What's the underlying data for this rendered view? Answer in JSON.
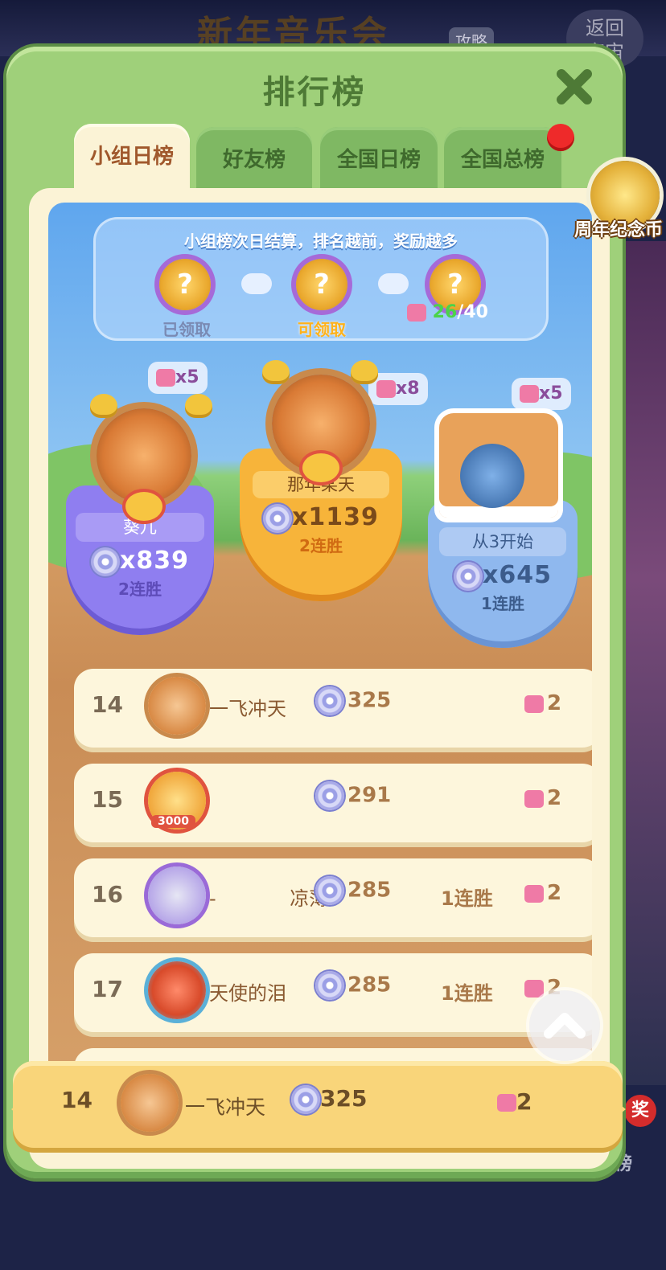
{
  "background": {
    "event_title": "新年音乐会",
    "strategy_tag": "攻略",
    "back_button": "返回\n宇宙",
    "prize_badge": "奖",
    "side_label": "行榜"
  },
  "panel": {
    "title": "排行榜",
    "tabs": [
      {
        "label": "小组日榜",
        "active": true
      },
      {
        "label": "好友榜",
        "active": false
      },
      {
        "label": "全国日榜",
        "active": false
      },
      {
        "label": "全国总榜",
        "active": false
      }
    ],
    "anniversary_coin_label": "周年纪念币"
  },
  "rewards": {
    "hint": "小组榜次日结算，排名越前，奖励越多",
    "chests": [
      {
        "label": "已领取",
        "color": "#7a8ab3"
      },
      {
        "label": "可领取",
        "color": "#ffb21a"
      },
      {
        "label": "",
        "color": "#ffffff"
      }
    ],
    "progress_current": "26",
    "progress_total": "/40"
  },
  "podium": [
    {
      "place": 2,
      "name": "葵儿",
      "score": "x839",
      "streak": "2连胜",
      "reward": "x5",
      "color": "#8f7ef0"
    },
    {
      "place": 1,
      "name": "那年某天",
      "score": "x1139",
      "streak": "2连胜",
      "reward": "x8",
      "color": "#f7b43a"
    },
    {
      "place": 3,
      "name": "从3开始",
      "score": "x645",
      "streak": "1连胜",
      "reward": "x5",
      "color": "#8fb8ee"
    }
  ],
  "rows": [
    {
      "rank": "14",
      "name": "一飞冲天",
      "score": "325",
      "streak": "",
      "tickets": "2"
    },
    {
      "rank": "15",
      "name": "",
      "score": "291",
      "streak": "",
      "tickets": "2",
      "avatar_badge": "3000"
    },
    {
      "rank": "16",
      "name": "-            凉薄",
      "score": "285",
      "streak": "1连胜",
      "tickets": "2"
    },
    {
      "rank": "17",
      "name": "天使的泪",
      "score": "285",
      "streak": "1连胜",
      "tickets": "2"
    }
  ],
  "my_rank": {
    "rank": "14",
    "name": "一飞冲天",
    "score": "325",
    "tickets": "2"
  },
  "icons": {
    "close": "close-icon",
    "scroll_top": "chevron-up-icon",
    "score": "disc-icon",
    "ticket": "ticket-icon"
  }
}
